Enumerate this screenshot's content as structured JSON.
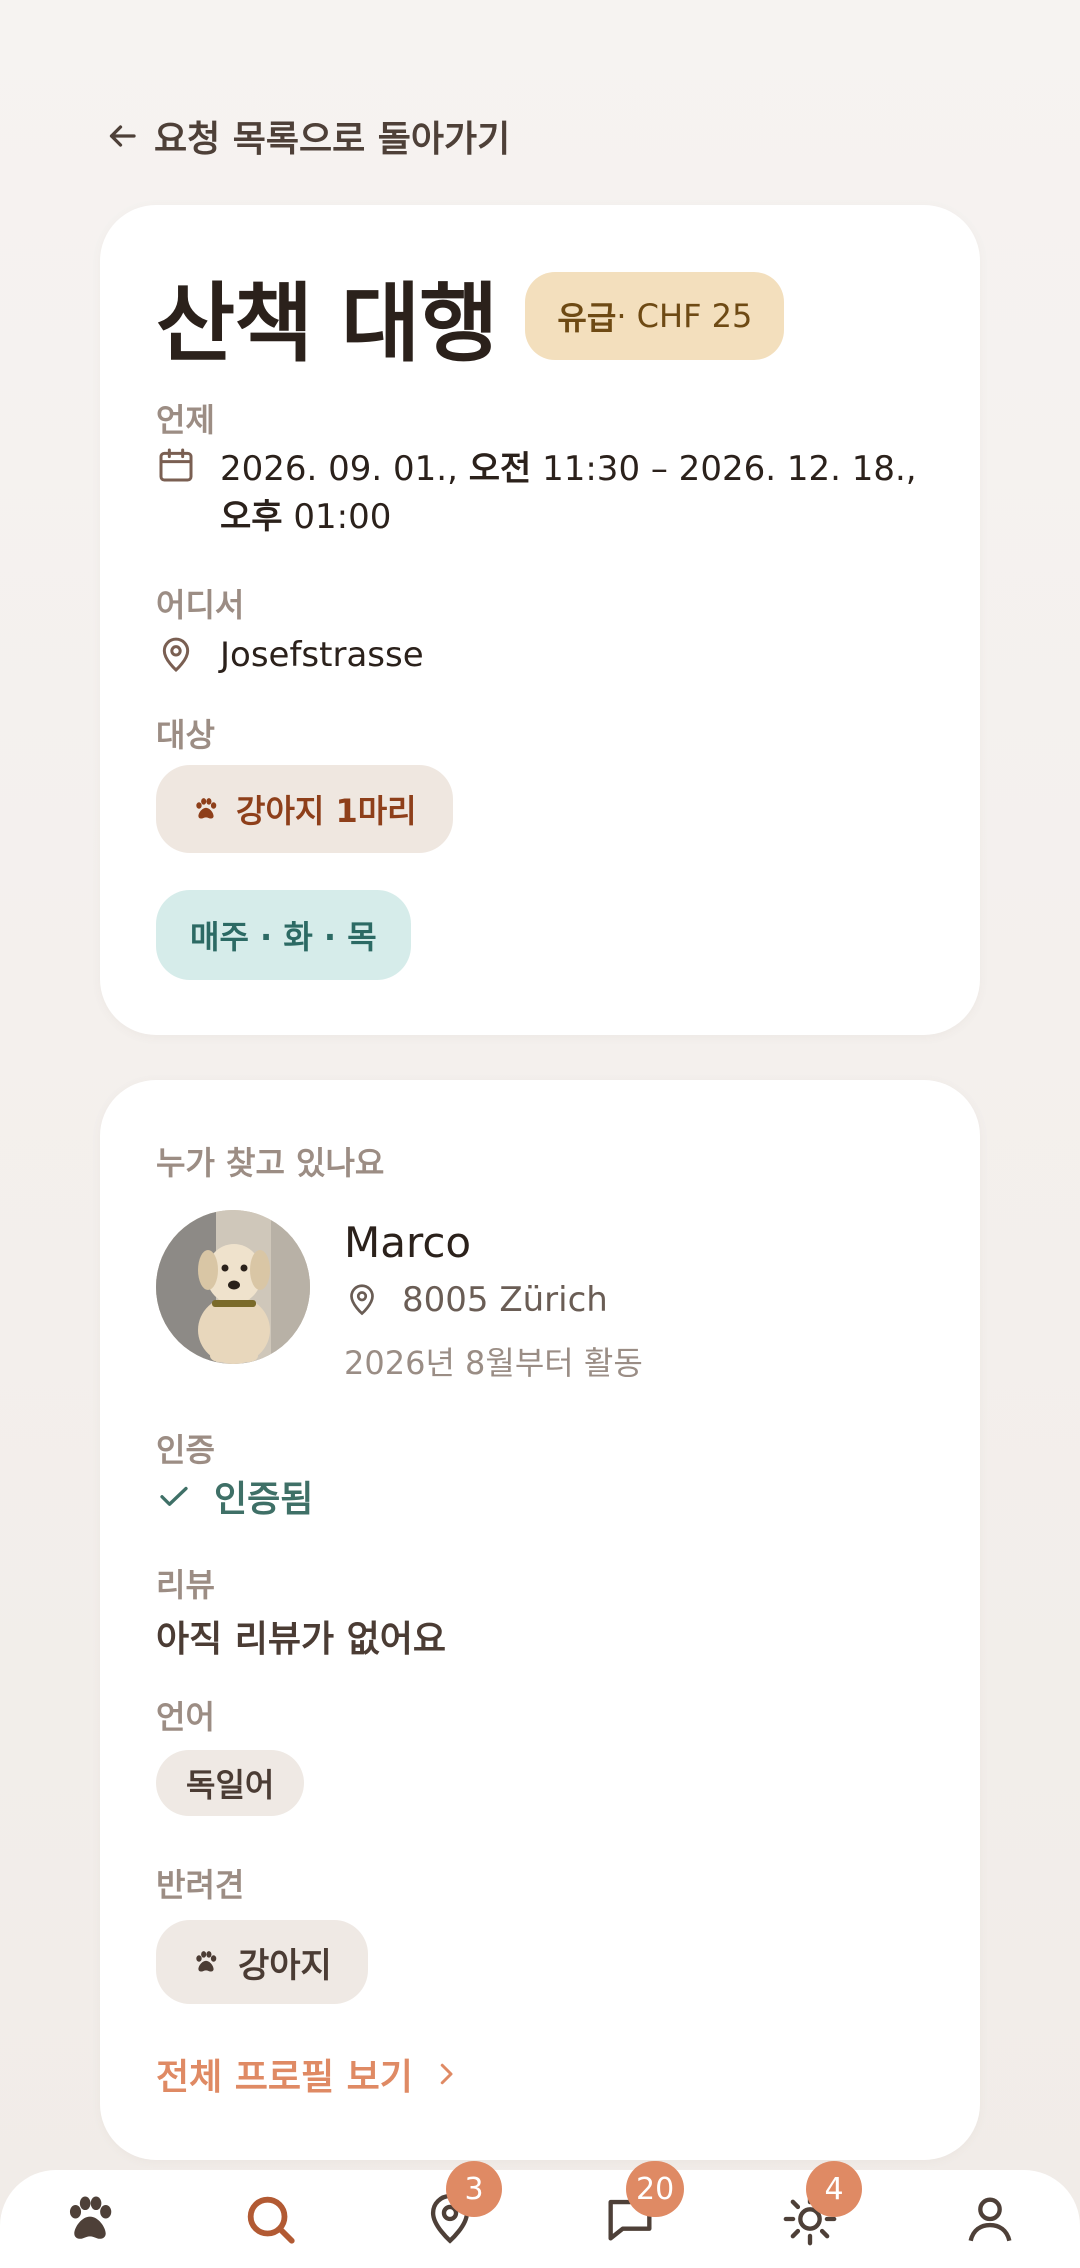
{
  "back": {
    "label": "요청 목록으로 돌아가기"
  },
  "request": {
    "title": "산책 대행",
    "paid_prefix": "유급",
    "paid_suffix": " · CHF 25",
    "when_label": "언제",
    "when": {
      "start_date": "2026. 09. 01., ",
      "start_ampm": "오전",
      "start_time": " 11:30 – 2026. 12. 18., ",
      "end_ampm": "오후",
      "end_time": " 01:00"
    },
    "where_label": "어디서",
    "where": "Josefstrasse",
    "target_label": "대상",
    "target": "강아지 1마리",
    "schedule": "매주 · 화 · 목"
  },
  "requester": {
    "section_title": "누가 찾고 있나요",
    "name": "Marco",
    "location": "8005 Zürich",
    "since": "2026년 8월부터 활동",
    "verification_label": "인증",
    "verification": "인증됨",
    "reviews_label": "리뷰",
    "reviews": "아직 리뷰가 없어요",
    "languages_label": "언어",
    "language": "독일어",
    "pets_label": "반려견",
    "pet": "강아지",
    "profile_link": "전체 프로필 보기"
  },
  "nav": {
    "items": [
      {
        "icon": "paw-icon"
      },
      {
        "icon": "search-icon"
      },
      {
        "icon": "map-pin-icon",
        "badge": "3"
      },
      {
        "icon": "chat-icon",
        "badge": "20"
      },
      {
        "icon": "sun-icon",
        "badge": "4"
      },
      {
        "icon": "profile-icon"
      }
    ]
  },
  "colors": {
    "accent": "#df8a64",
    "paid_bg": "#f3dfbd",
    "schedule_bg": "#d6ecea",
    "verified": "#3f7067"
  }
}
